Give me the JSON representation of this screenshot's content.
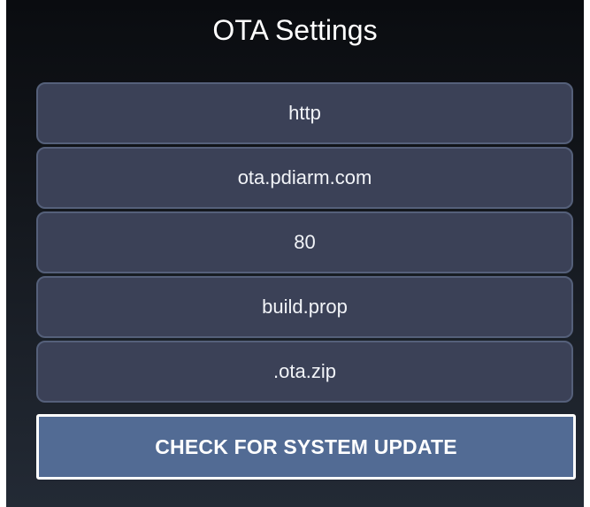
{
  "header": {
    "title": "OTA Settings"
  },
  "fields": [
    {
      "value": "http"
    },
    {
      "value": "ota.pdiarm.com"
    },
    {
      "value": "80"
    },
    {
      "value": "build.prop"
    },
    {
      "value": ".ota.zip"
    }
  ],
  "actions": {
    "check_label": "CHECK FOR SYSTEM UPDATE"
  },
  "colors": {
    "field_bg": "#3b4157",
    "field_border": "#55607a",
    "button_bg": "#526b94",
    "button_border": "#ffffff"
  }
}
